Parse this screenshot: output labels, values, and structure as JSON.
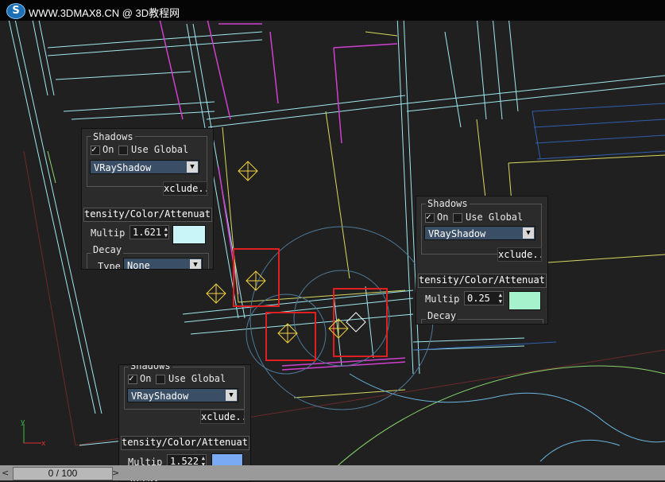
{
  "app": {
    "site_text": "WWW.3DMAX8.CN @ 3D教程网",
    "logo_glyph": "S"
  },
  "panels": [
    {
      "shadows_title": "Shadows",
      "on_label": "On",
      "on_checked": true,
      "use_global_label": "Use Global",
      "use_global_checked": false,
      "shadow_type": "VRayShadow",
      "exclude_label": "xclude..",
      "rollout_label": "tensity/Color/Attenuati",
      "multiplier_label": "Multip",
      "multiplier_value": "1.621",
      "color": "#c9f4f8",
      "decay_label": "Decay",
      "type_label": "Type",
      "type_value": "None"
    },
    {
      "shadows_title": "Shadows",
      "on_label": "On",
      "on_checked": true,
      "use_global_label": "Use Global",
      "use_global_checked": false,
      "shadow_type": "VRayShadow",
      "exclude_label": "xclude..",
      "rollout_label": "tensity/Color/Attenuati",
      "multiplier_label": "Multip",
      "multiplier_value": "0.25",
      "color": "#a6f2cd",
      "decay_label": "Decay"
    },
    {
      "shadows_title": "Shadows",
      "on_label": "On",
      "on_checked": true,
      "use_global_label": "Use Global",
      "use_global_checked": false,
      "shadow_type": "VRayShadow",
      "exclude_label": "xclude..",
      "rollout_label": "tensity/Color/Attenuati",
      "multiplier_label": "Multip",
      "multiplier_value": "1.522",
      "color": "#7aaaf4",
      "decay_label": "Decay"
    }
  ],
  "timeline": {
    "frame_text": "0 / 100",
    "prev_glyph": "<",
    "next_glyph": ">"
  },
  "axis": {
    "x_label": "x",
    "y_label": "y"
  }
}
